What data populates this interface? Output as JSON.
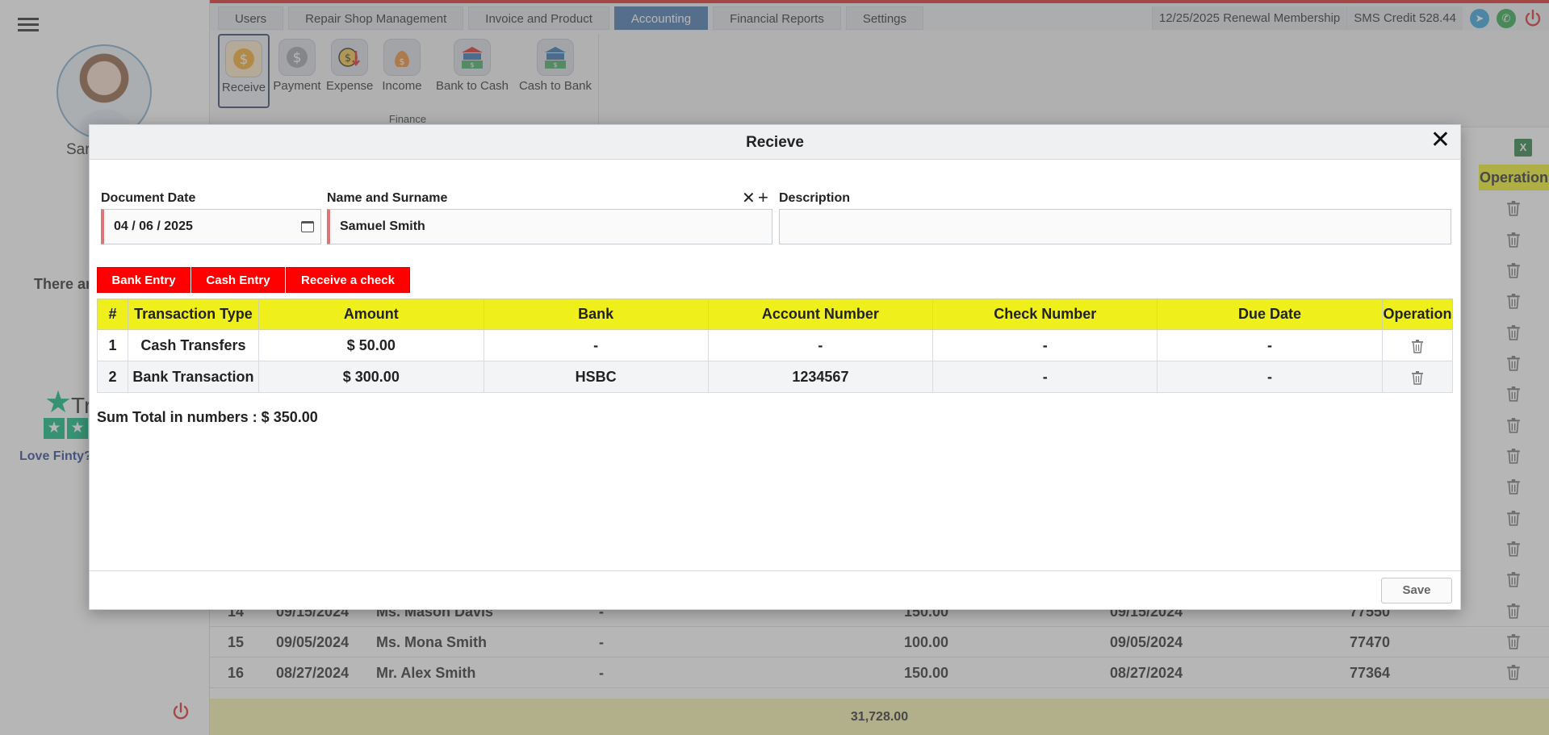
{
  "sidebar": {
    "user_name_visible": "Sar",
    "notice_visible": "There ar",
    "trust_word": "Tr",
    "trust_link": "Love Finty?"
  },
  "tabs": [
    {
      "label": "Users"
    },
    {
      "label": "Repair Shop Management"
    },
    {
      "label": "Invoice and Product"
    },
    {
      "label": "Accounting",
      "active": true
    },
    {
      "label": "Financial Reports"
    },
    {
      "label": "Settings"
    }
  ],
  "topbar": {
    "membership": "12/25/2025 Renewal Membership",
    "sms_credit": "SMS Credit 528.44",
    "icons": [
      "telegram-icon",
      "whatsapp-icon",
      "power-icon"
    ],
    "colors": {
      "accent_red": "#d92121",
      "tab_active": "#3c6fa8",
      "telegram": "#2a9fd8",
      "whatsapp": "#25a244"
    }
  },
  "ribbon": {
    "group_label": "Finance",
    "buttons": [
      {
        "label": "Receive",
        "icon": "receive-money-icon",
        "active": true
      },
      {
        "label": "Payment",
        "icon": "payment-money-icon"
      },
      {
        "label": "Expense",
        "icon": "expense-icon"
      },
      {
        "label": "Income",
        "icon": "income-bag-icon"
      },
      {
        "label": "Bank to Cash",
        "icon": "bank-to-cash-icon"
      },
      {
        "label": "Cash to Bank",
        "icon": "cash-to-bank-icon"
      }
    ]
  },
  "background_table": {
    "operation_header": "Operation",
    "rows": [
      {
        "no": "14",
        "date": "09/15/2024",
        "name": "Ms. Mason Davis",
        "col4": "-",
        "amount": "150.00",
        "date2": "09/15/2024",
        "ref": "77550"
      },
      {
        "no": "15",
        "date": "09/05/2024",
        "name": "Ms. Mona Smith",
        "col4": "-",
        "amount": "100.00",
        "date2": "09/05/2024",
        "ref": "77470"
      },
      {
        "no": "16",
        "date": "08/27/2024",
        "name": "Mr. Alex Smith",
        "col4": "-",
        "amount": "150.00",
        "date2": "08/27/2024",
        "ref": "77364"
      }
    ],
    "footer_total": "31,728.00"
  },
  "modal": {
    "title": "Recieve",
    "document_date_label": "Document Date",
    "document_date_value": "04 / 06 / 2025",
    "name_label": "Name and Surname",
    "name_value": "Samuel Smith",
    "description_label": "Description",
    "description_value": "",
    "entry_buttons": [
      "Bank Entry",
      "Cash Entry",
      "Receive a check"
    ],
    "table": {
      "headers": [
        "#",
        "Transaction Type",
        "Amount",
        "Bank",
        "Account Number",
        "Check Number",
        "Due Date",
        "Operation"
      ],
      "rows": [
        [
          "1",
          "Cash Transfers",
          "$ 50.00",
          "-",
          "-",
          "-",
          "-"
        ],
        [
          "2",
          "Bank Transaction",
          "$ 300.00",
          "HSBC",
          "1234567",
          "-",
          "-"
        ]
      ]
    },
    "sum_total": "Sum Total in numbers : $ 350.00",
    "save_label": "Save",
    "colors": {
      "header_yellow": "#eff01b",
      "entry_red": "#ff0000"
    }
  }
}
